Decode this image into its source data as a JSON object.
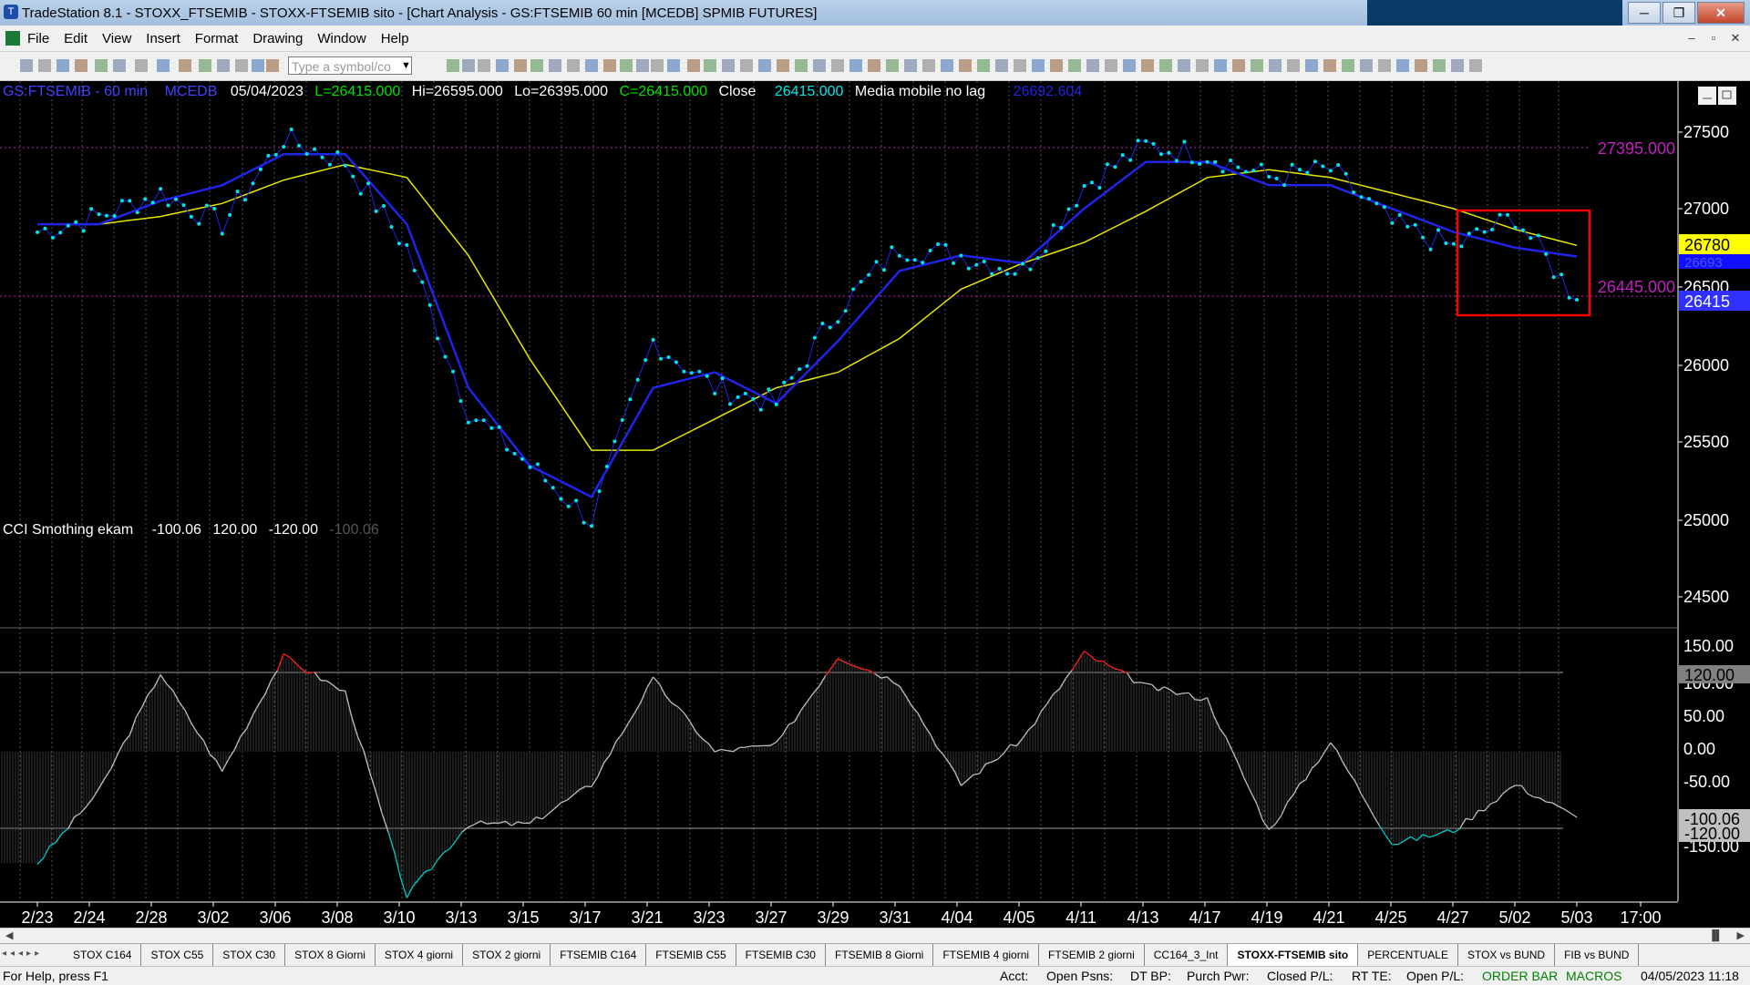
{
  "window": {
    "title": "TradeStation 8.1 - STOXX_FTSEMIB - STOXX-FTSEMIB sito - [Chart Analysis - GS:FTSEMIB  60 min  [MCEDB] SPMIB FUTURES]",
    "minimize": "─",
    "restore": "❐",
    "close": "✕"
  },
  "menu": {
    "items": [
      "File",
      "Edit",
      "View",
      "Insert",
      "Format",
      "Drawing",
      "Window",
      "Help"
    ],
    "mdi_minimize": "–",
    "mdi_restore": "▫",
    "mdi_close": "✕"
  },
  "toolbar": {
    "symbol_placeholder": "Type a symbol/co"
  },
  "header": {
    "symbol": "GS:FTSEMIB - 60 min",
    "code": "MCEDB",
    "date": "05/04/2023",
    "last": "L=26415.000",
    "high": "Hi=26595.000",
    "low": "Lo=26395.000",
    "close_eq": "C=26415.000",
    "close_label": "Close",
    "close_value": "26415.000",
    "ma_label": "Media mobile no lag",
    "ma_value": "26692.604"
  },
  "levels": {
    "upper": "27395.000",
    "lower": "26445.000"
  },
  "price_scale": {
    "ticks": [
      "27500",
      "27000",
      "26500",
      "26000",
      "25500",
      "25000",
      "24500"
    ],
    "tags": {
      "yellow": "26780",
      "blue": "26693",
      "current": "26415"
    }
  },
  "indicator": {
    "name": "CCI Smothing ekam",
    "v1": "-100.06",
    "v2": "120.00",
    "v3": "-120.00",
    "v4": "-100.06",
    "ticks": [
      "150.00",
      "100.00",
      "50.00",
      "0.00",
      "-50.00",
      "-150.00"
    ],
    "tags": {
      "upper": "120.00",
      "current": "-100.06",
      "lower": "-120.00"
    }
  },
  "time_axis": [
    "2/23",
    "2/24",
    "2/28",
    "3/02",
    "3/06",
    "3/08",
    "3/10",
    "3/13",
    "3/15",
    "3/17",
    "3/21",
    "3/23",
    "3/27",
    "3/29",
    "3/31",
    "4/04",
    "4/05",
    "4/11",
    "4/13",
    "4/17",
    "4/19",
    "4/21",
    "4/25",
    "4/27",
    "5/02",
    "5/03",
    "17:00"
  ],
  "tabs": [
    "STOX C164",
    "STOX C55",
    "STOX  C30",
    "STOX  8 Giorni",
    "STOX 4 giorni",
    "STOX  2 giorni",
    "FTSEMIB C164",
    "FTSEMIB C55",
    "FTSEMIB C30",
    "FTSEMIB  8 Giorni",
    "FTSEMIB  4 giorni",
    "FTSEMIB  2 giorni",
    "CC164_3_Int",
    "STOXX-FTSEMIB sito",
    "PERCENTUALE",
    "STOX vs BUND",
    "FIB vs BUND"
  ],
  "active_tab": "STOXX-FTSEMIB sito",
  "status": {
    "help": "For Help, press F1",
    "acct": "Acct:",
    "open_psns": "Open Psns:",
    "dt_bp": "DT BP:",
    "purch_pwr": "Purch Pwr:",
    "closed_pl": "Closed P/L:",
    "rt_te": "RT TE:",
    "open_pl": "Open P/L:",
    "order_bar": "ORDER BAR",
    "macros": "MACROS",
    "datetime": "04/05/2023 11:18"
  },
  "colors": {
    "price": "#00e5e5",
    "ma_blue": "#1f24e8",
    "ma_yellow": "#e6e600",
    "level": "#c020c0",
    "highlight_box": "#ff0000",
    "cci": "#bfbfbf",
    "cci_high": "#ff2020",
    "cci_low": "#00c8c8"
  },
  "chart_data": [
    {
      "type": "line",
      "title": "GS:FTSEMIB - 60 min",
      "x": [
        "2/23",
        "2/24",
        "2/28",
        "3/02",
        "3/06",
        "3/08",
        "3/10",
        "3/13",
        "3/15",
        "3/17",
        "3/21",
        "3/23",
        "3/27",
        "3/29",
        "3/31",
        "4/04",
        "4/05",
        "4/11",
        "4/13",
        "4/17",
        "4/19",
        "4/21",
        "4/25",
        "4/27",
        "5/02",
        "5/03"
      ],
      "series": [
        {
          "name": "Close",
          "values": [
            26850,
            26950,
            27100,
            26900,
            27450,
            27300,
            26750,
            25700,
            25350,
            25000,
            26150,
            25850,
            25750,
            26350,
            26750,
            26700,
            26600,
            27150,
            27400,
            27350,
            27200,
            27250,
            26900,
            26750,
            26950,
            26415
          ]
        },
        {
          "name": "Media mobile no lag",
          "values": [
            26900,
            26900,
            27050,
            27150,
            27350,
            27350,
            26900,
            25850,
            25350,
            25150,
            25850,
            25950,
            25750,
            26150,
            26600,
            26700,
            26650,
            27000,
            27300,
            27300,
            27150,
            27150,
            27000,
            26850,
            26750,
            26693
          ]
        }
      ],
      "ylim": [
        24300,
        27700
      ],
      "levels": [
        27395,
        26445
      ]
    },
    {
      "type": "area",
      "title": "CCI Smothing ekam",
      "x": [
        "2/23",
        "2/24",
        "2/28",
        "3/02",
        "3/06",
        "3/08",
        "3/10",
        "3/13",
        "3/15",
        "3/17",
        "3/21",
        "3/23",
        "3/27",
        "3/29",
        "3/31",
        "4/04",
        "4/05",
        "4/11",
        "4/13",
        "4/17",
        "4/19",
        "4/21",
        "4/25",
        "4/27",
        "5/02",
        "5/03"
      ],
      "series": [
        {
          "name": "CCI Smothing ekam",
          "values": [
            -170,
            -60,
            120,
            -30,
            145,
            90,
            -220,
            -110,
            -110,
            -50,
            110,
            0,
            10,
            145,
            105,
            -50,
            20,
            150,
            100,
            80,
            -120,
            15,
            -140,
            -120,
            -50,
            -100.06
          ]
        }
      ],
      "levels": [
        120,
        -120
      ],
      "ylim": [
        -230,
        165
      ]
    }
  ]
}
